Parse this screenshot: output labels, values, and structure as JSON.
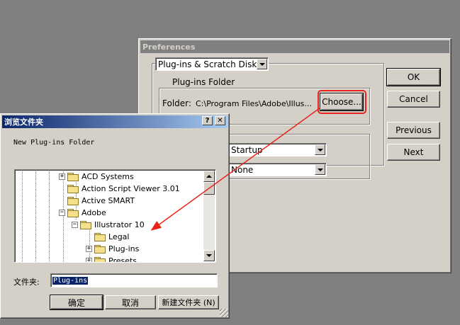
{
  "preferences": {
    "title": "Preferences",
    "section_value": "Plug-ins & Scratch Disks",
    "plugins_group_label": "Plug-ins Folder",
    "folder_label": "Folder:",
    "folder_path": "C:\\Program Files\\Adobe\\Illus...",
    "choose_label": "Choose...",
    "scratch_primary_value": "Startup",
    "scratch_secondary_value": "None",
    "ok_label": "OK",
    "cancel_label": "Cancel",
    "previous_label": "Previous",
    "next_label": "Next"
  },
  "browse": {
    "title": "浏览文件夹",
    "help_label": "?",
    "close_label": "✕",
    "prompt": "New Plug-ins Folder",
    "tree_items": [
      {
        "label": "ACD Systems",
        "level": 3,
        "expander": "+"
      },
      {
        "label": "Action Script Viewer 3.01",
        "level": 3,
        "expander": ""
      },
      {
        "label": "Active SMART",
        "level": 3,
        "expander": ""
      },
      {
        "label": "Adobe",
        "level": 3,
        "expander": "−"
      },
      {
        "label": "Illustrator 10",
        "level": 4,
        "expander": "−"
      },
      {
        "label": "Legal",
        "level": 5,
        "expander": ""
      },
      {
        "label": "Plug-ins",
        "level": 5,
        "expander": "+"
      },
      {
        "label": "Presets",
        "level": 5,
        "expander": "+"
      }
    ],
    "folder_label": "文件夹:",
    "folder_value": "Plug-ins",
    "ok_label": "确定",
    "cancel_label": "取消",
    "new_folder_label": "新建文件夹 (N)"
  },
  "colors": {
    "annotation": "#e8241c",
    "active_title": "#0a246a",
    "inactive_title": "#808080"
  }
}
